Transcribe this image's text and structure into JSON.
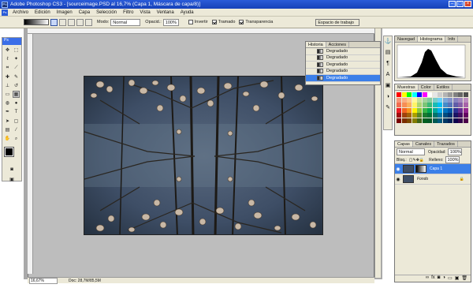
{
  "window": {
    "title": "Adobe Photoshop CS3 - [sourceimage.PSD al 16,7% (Capa 1, Máscara de capa/8)]"
  },
  "menu": {
    "logo": "Ps",
    "items": [
      "Archivo",
      "Edición",
      "Imagen",
      "Capa",
      "Selección",
      "Filtro",
      "Vista",
      "Ventana",
      "Ayuda"
    ]
  },
  "options": {
    "modo_label": "Modo:",
    "modo_value": "Normal",
    "opacidad_label": "Opacid.:",
    "opacidad_value": "100%",
    "invertir": "Invertir",
    "tramado": "Tramado",
    "transparencia": "Transparencia",
    "workspace": "Espacio de trabajo"
  },
  "history": {
    "tabs": [
      "Historia",
      "Acciones"
    ],
    "items": [
      "Degradado",
      "Degradado",
      "Degradado",
      "Degradado",
      "Degradado"
    ],
    "selected_index": 4
  },
  "nav": {
    "tabs": [
      "Navegad",
      "Histograma",
      "Info"
    ]
  },
  "swatches": {
    "tabs": [
      "Muestras",
      "Color",
      "Estilos"
    ]
  },
  "layers": {
    "tabs": [
      "Capas",
      "Canales",
      "Trazados"
    ],
    "blend": "Normal",
    "opacity_label": "Opacidad:",
    "opacity_value": "100%",
    "lock_label": "Bloq.:",
    "fill_label": "Relleno:",
    "fill_value": "100%",
    "rows": [
      {
        "name": "Capa 1"
      },
      {
        "name": "Fondo"
      }
    ]
  },
  "status": {
    "zoom": "16,67%",
    "doc": "Doc: 28,7M/85,5M"
  },
  "toolbox": {
    "logo": "Ps"
  },
  "colors": {
    "title_bg": "#1f4fcf",
    "accent": "#3b7fe8",
    "ui": "#ece9d8"
  }
}
